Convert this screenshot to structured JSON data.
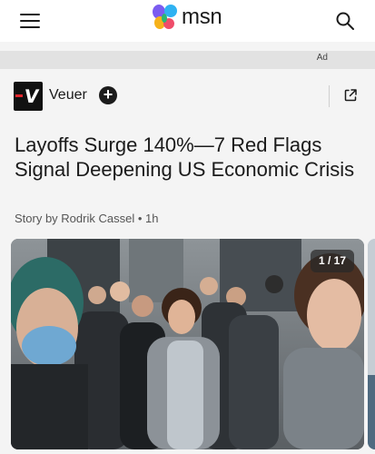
{
  "header": {
    "brand": "msn",
    "menu_icon": "hamburger-menu-icon",
    "search_icon": "search-icon"
  },
  "ad": {
    "label": "Ad"
  },
  "publisher": {
    "name": "Veuer",
    "logo_icon": "veuer-logo",
    "follow_icon": "plus-icon",
    "share_icon": "external-share-icon",
    "brand_color": "#e3262d"
  },
  "article": {
    "headline": "Layoffs Surge 140%—7 Red Flags Signal Deepening US Economic Crisis",
    "byline": "Story by Rodrik Cassel • 1h"
  },
  "gallery": {
    "counter": "1 / 17",
    "photo_subject": "crowd-of-people-in-winter-coats"
  },
  "colors": {
    "background": "#f4f4f4",
    "topbar": "#ffffff",
    "adbar": "#e2e2e2",
    "text": "#1b1b1b"
  }
}
